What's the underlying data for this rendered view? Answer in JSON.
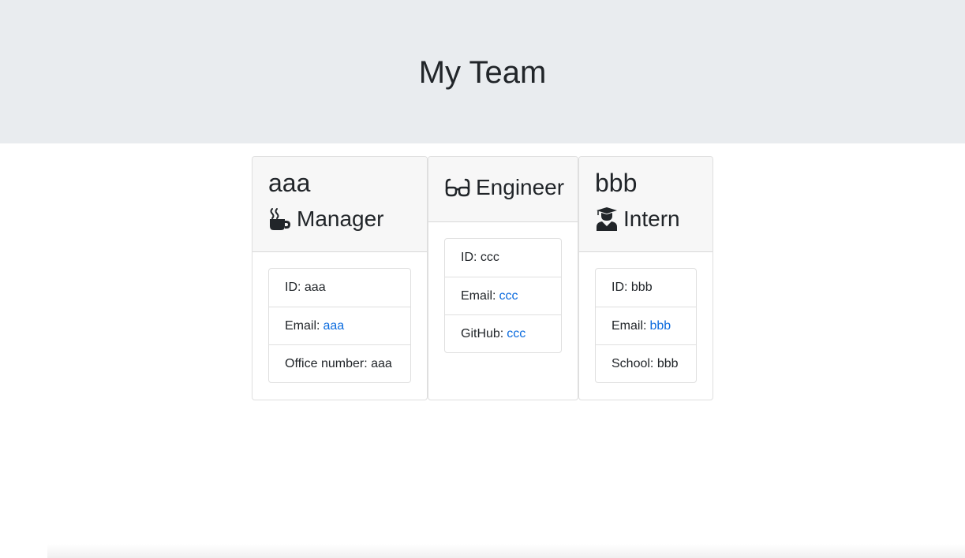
{
  "header": {
    "title": "My Team"
  },
  "cards": [
    {
      "name": "aaa",
      "role": "Manager",
      "icon": "mug-icon",
      "items": [
        {
          "label": "ID:",
          "value": "aaa"
        },
        {
          "label": "Email:",
          "value": "aaa"
        },
        {
          "label": "Office number:",
          "value": "aaa"
        }
      ]
    },
    {
      "name": "",
      "role": "Engineer",
      "icon": "glasses-icon",
      "items": [
        {
          "label": "ID:",
          "value": "ccc"
        },
        {
          "label": "Email:",
          "value": "ccc"
        },
        {
          "label": "GitHub:",
          "value": "ccc"
        }
      ]
    },
    {
      "name": "bbb",
      "role": "Intern",
      "icon": "graduate-icon",
      "items": [
        {
          "label": "ID:",
          "value": "bbb"
        },
        {
          "label": "Email:",
          "value": "bbb"
        },
        {
          "label": "School:",
          "value": "bbb"
        }
      ]
    }
  ],
  "colors": {
    "header_bg": "#e9ecef",
    "card_header_bg": "#f7f7f7",
    "link": "#0b6bde",
    "text": "#212529"
  }
}
